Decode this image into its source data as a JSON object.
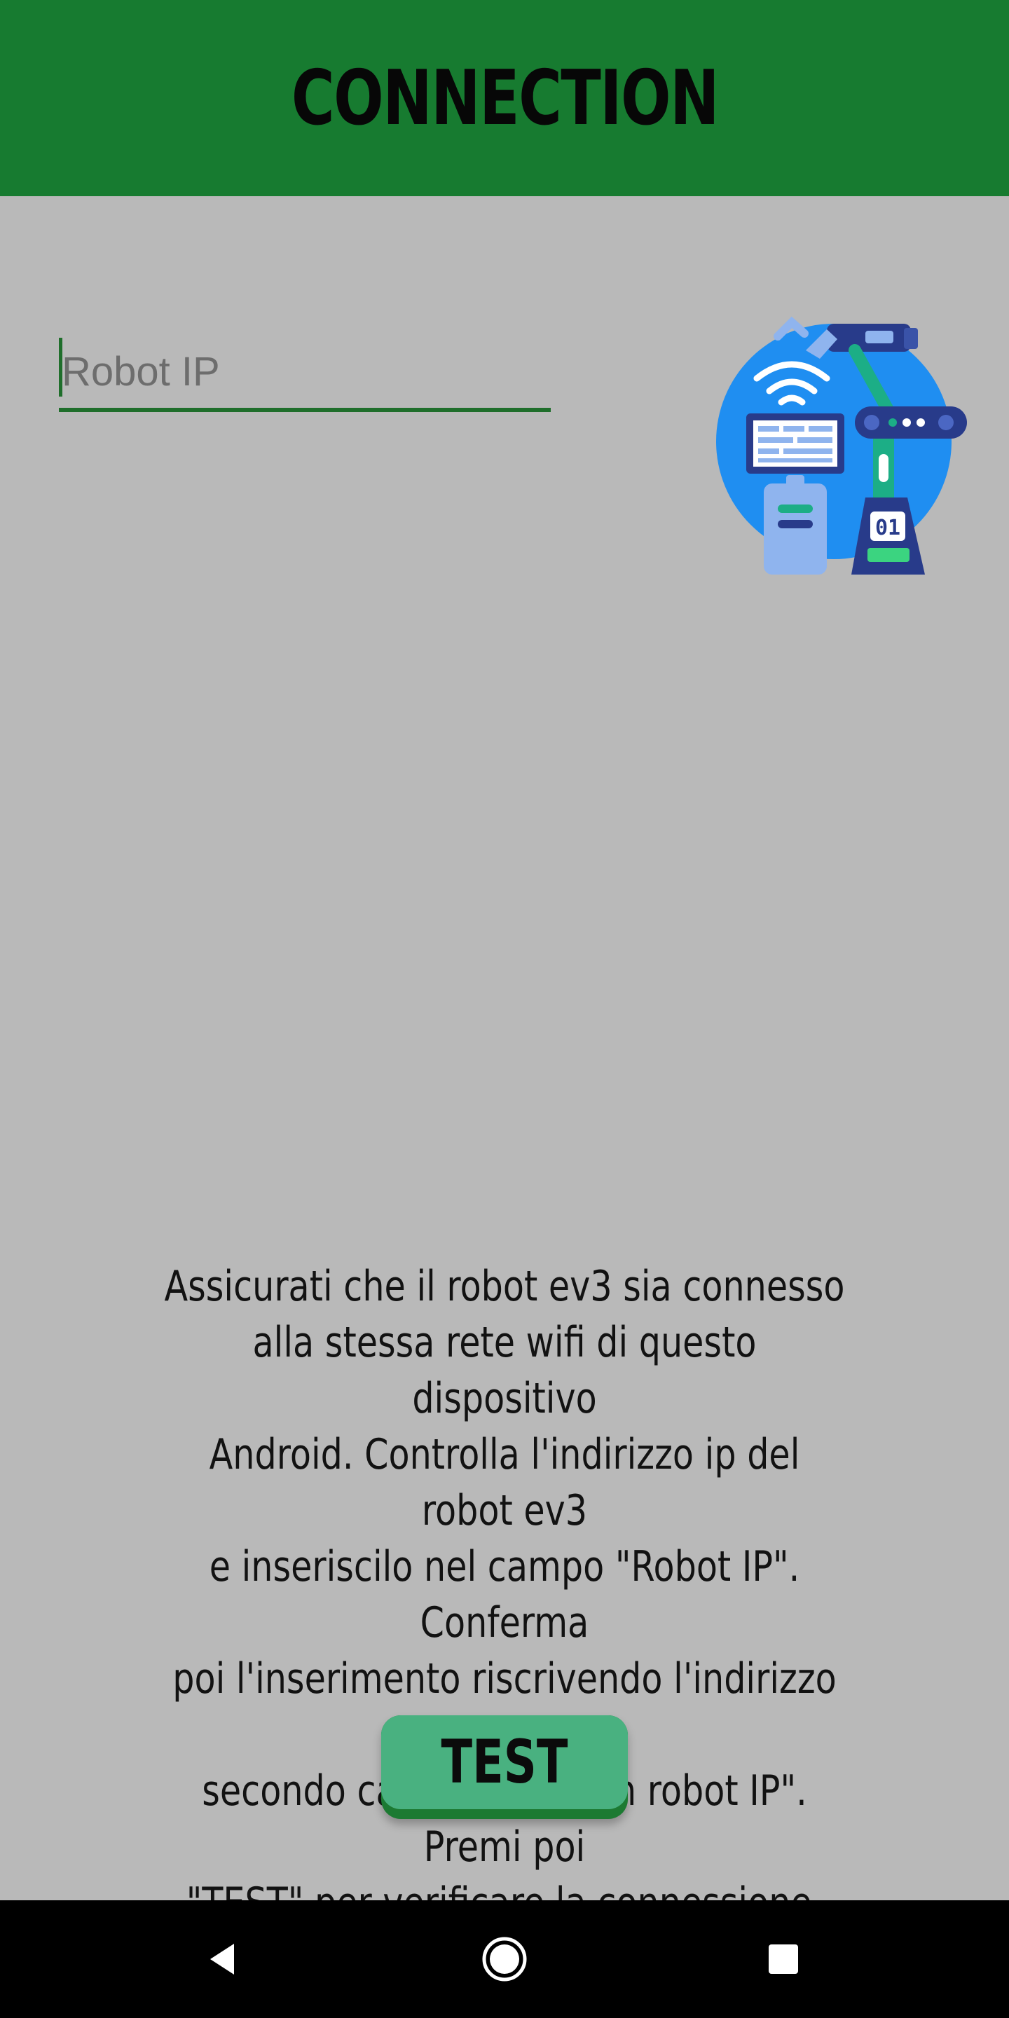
{
  "header": {
    "title": "CONNECTION",
    "background_color": "#177b30"
  },
  "form": {
    "robot_ip": {
      "placeholder": "Robot IP",
      "value": ""
    }
  },
  "illustration": {
    "icon": "robot-network-illustration-icon"
  },
  "instructions": {
    "text": "Assicurati che il robot ev3 sia connesso\nalla stessa rete wifi di questo dispositivo\nAndroid. Controlla l'indirizzo ip del robot ev3\ne inseriscilo nel campo \"Robot IP\". Conferma\npoi l'inserimento riscrivendo l'indirizzo ip nel\nsecondo campo \"Confirm robot IP\". Premi poi\n\"TEST\" per verificare la connessione."
  },
  "actions": {
    "test_label": "TEST",
    "button_color": "#49b180"
  },
  "system_nav": {
    "back_icon": "back-triangle-icon",
    "home_icon": "home-circle-icon",
    "recents_icon": "recents-square-icon"
  }
}
